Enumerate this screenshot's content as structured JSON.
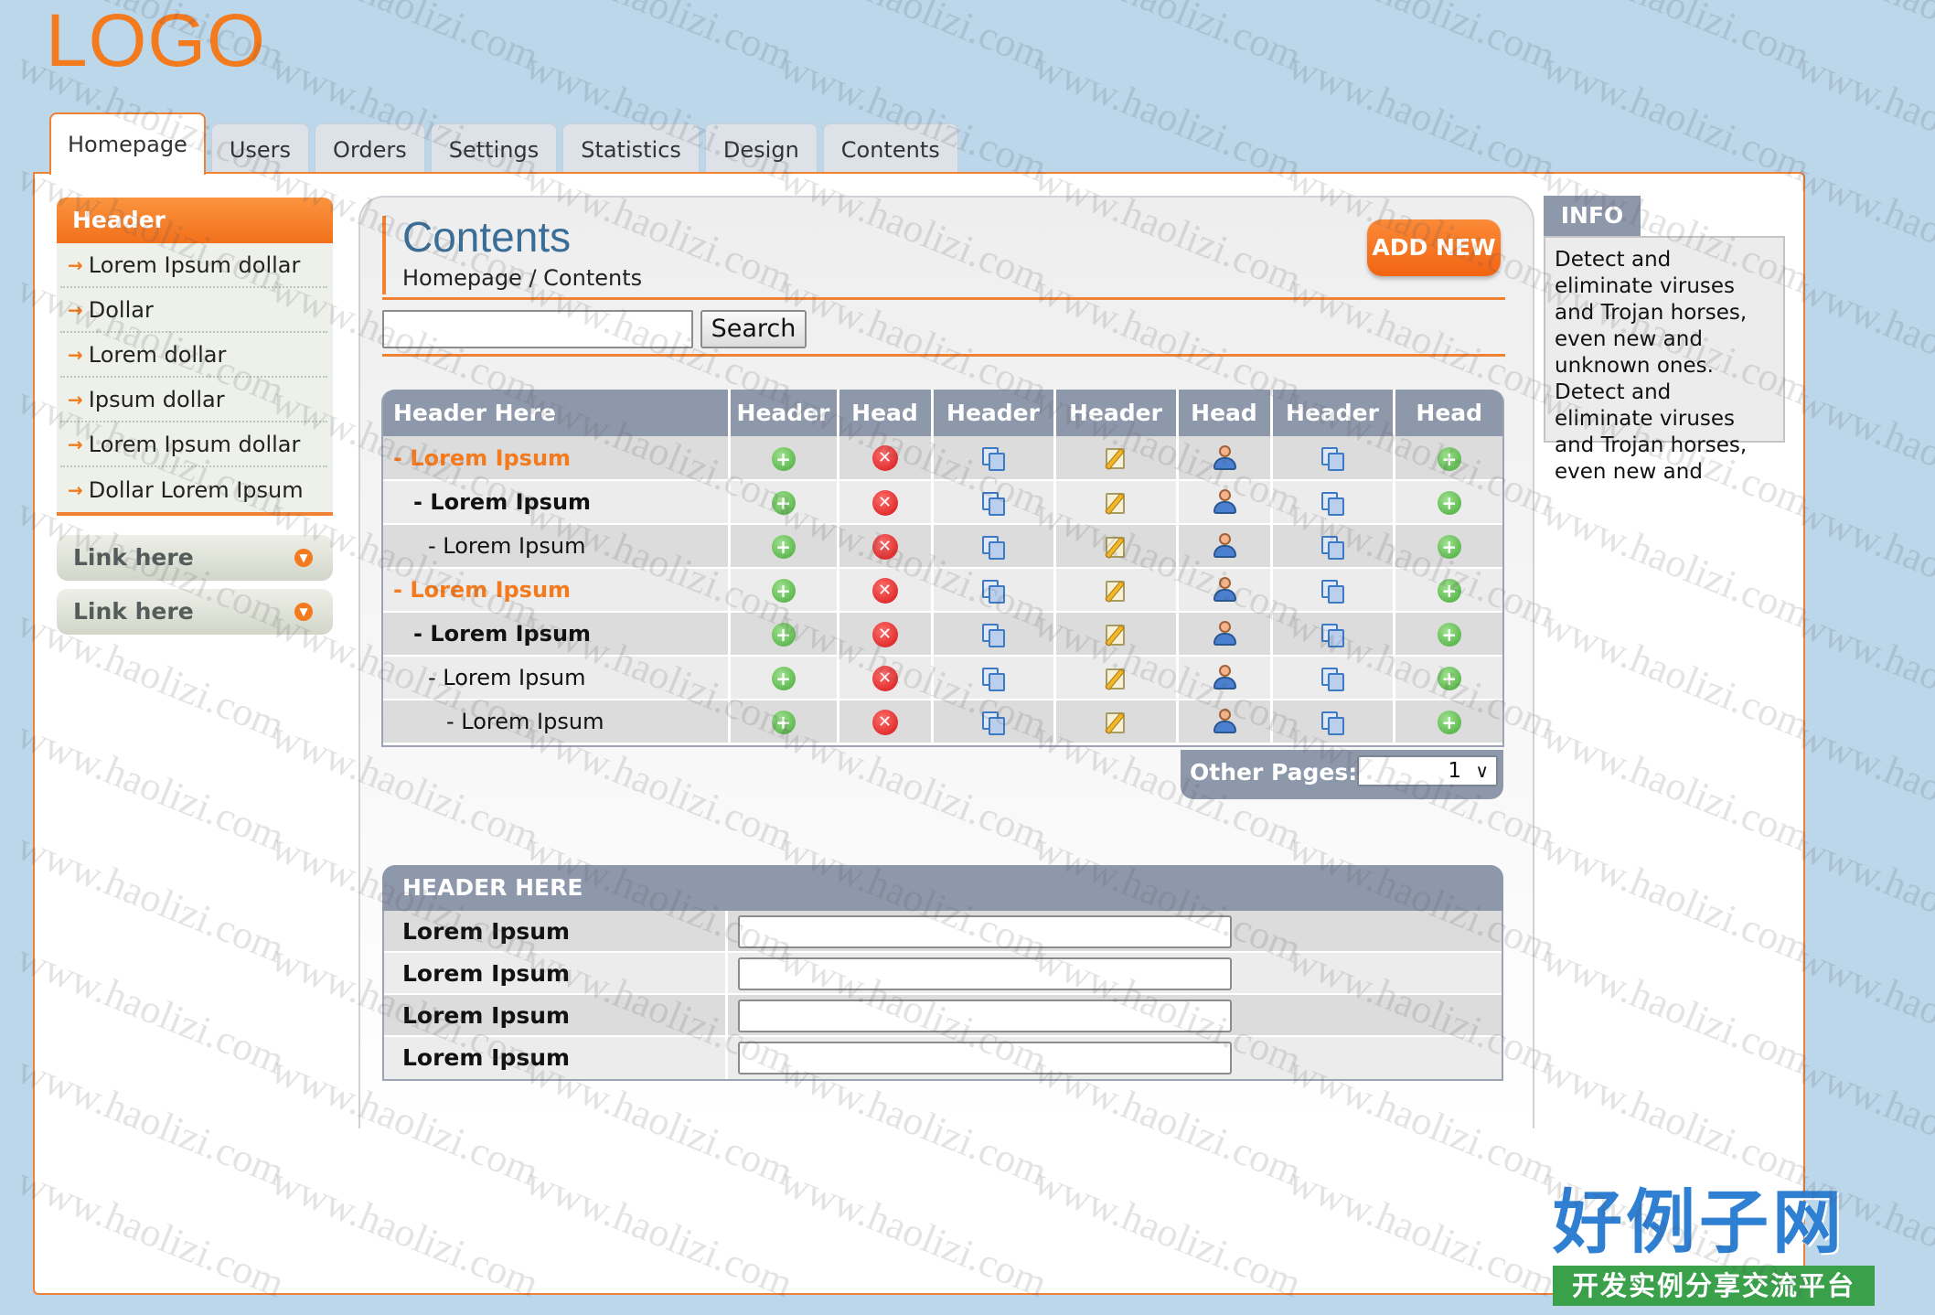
{
  "logo": "LOGO",
  "tabs": [
    "Homepage",
    "Users",
    "Orders",
    "Settings",
    "Statistics",
    "Design",
    "Contents"
  ],
  "sidebar": {
    "header": "Header",
    "items": [
      "Lorem Ipsum dollar",
      "Dollar",
      "Lorem dollar",
      "Ipsum dollar",
      "Lorem Ipsum dollar",
      "Dollar Lorem Ipsum"
    ],
    "links": [
      "Link here",
      "Link here"
    ]
  },
  "content": {
    "title": "Contents",
    "breadcrumb": "Homepage / Contents",
    "add_new": "ADD NEW",
    "search_button": "Search",
    "search_value": ""
  },
  "table": {
    "headers": [
      "Header Here",
      "Header",
      "Head",
      "Header",
      "Header",
      "Head",
      "Header",
      "Head"
    ],
    "rows": [
      {
        "label": "- Lorem Ipsum",
        "level": 0
      },
      {
        "label": "- Lorem Ipsum",
        "level": 1
      },
      {
        "label": "- Lorem Ipsum",
        "level": 2
      },
      {
        "label": "- Lorem Ipsum",
        "level": 0
      },
      {
        "label": "- Lorem Ipsum",
        "level": 1
      },
      {
        "label": "- Lorem Ipsum",
        "level": 2
      },
      {
        "label": "- Lorem Ipsum",
        "level": 3
      }
    ],
    "row_icons": [
      "add-icon",
      "delete-icon",
      "copy-icon",
      "edit-icon",
      "user-icon",
      "copy-icon",
      "add-icon"
    ],
    "pager_label": "Other Pages:",
    "pager_value": "1"
  },
  "form": {
    "header": "HEADER HERE",
    "rows": [
      {
        "label": "Lorem Ipsum",
        "value": ""
      },
      {
        "label": "Lorem Ipsum",
        "value": ""
      },
      {
        "label": "Lorem Ipsum",
        "value": ""
      },
      {
        "label": "Lorem Ipsum",
        "value": ""
      }
    ]
  },
  "info": {
    "title": "INFO",
    "text": "Detect and eliminate viruses and Trojan horses, even new and unknown ones. Detect and eliminate viruses and Trojan horses, even new and"
  },
  "watermark": "www.haolizi.com",
  "brand": {
    "name": "好例子网",
    "tagline": "开发实例分享交流平台"
  },
  "colors": {
    "accent": "#f08236",
    "header_bg": "#8e98ab",
    "page_bg": "#bcd7ea",
    "title_blue": "#3b6e97"
  }
}
